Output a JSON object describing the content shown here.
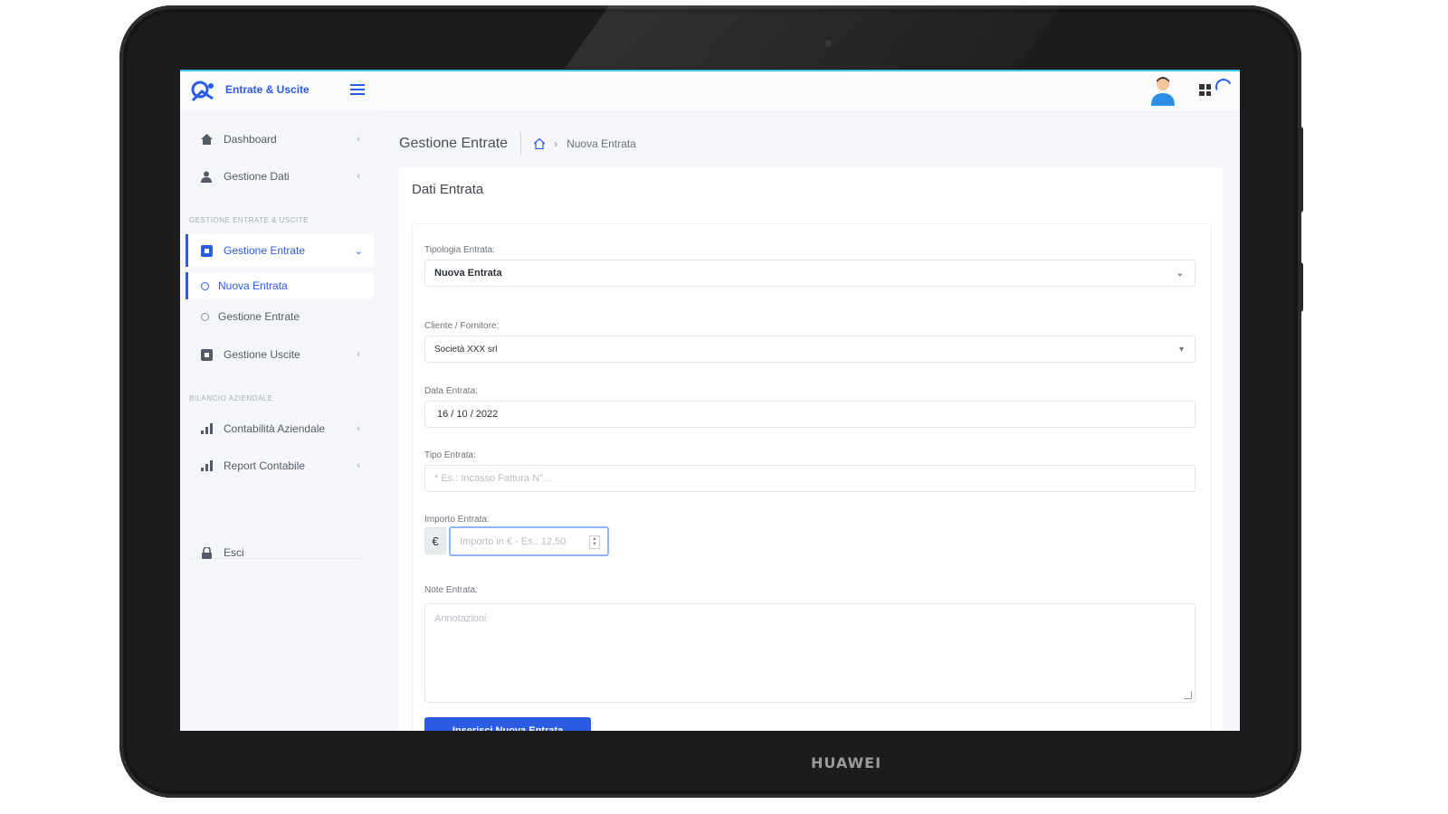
{
  "device": {
    "brand": "HUAWEI"
  },
  "app": {
    "title": "Entrate & Uscite"
  },
  "sidebar": {
    "items": [
      {
        "label": "Dashboard",
        "icon": "home-icon"
      },
      {
        "label": "Gestione Dati",
        "icon": "user-icon"
      }
    ],
    "section1": "GESTIONE ENTRATE & USCITE",
    "entrate": {
      "label": "Gestione Entrate",
      "icon": "calendar-icon"
    },
    "subitems": [
      {
        "label": "Nuova Entrata"
      },
      {
        "label": "Gestione Entrate"
      }
    ],
    "uscite": {
      "label": "Gestione Uscite",
      "icon": "calendar-icon"
    },
    "section2": "BILANCIO AZIENDALE",
    "items2": [
      {
        "label": "Contabilità Aziendale",
        "icon": "bar-chart-icon"
      },
      {
        "label": "Report Contabile",
        "icon": "bar-chart-icon"
      }
    ],
    "logout": {
      "label": "Esci",
      "icon": "lock-icon"
    }
  },
  "header": {
    "title": "Gestione Entrate",
    "breadcrumb_current": "Nuova Entrata"
  },
  "form": {
    "card_title": "Dati Entrata",
    "tipologia": {
      "label": "Tipologia Entrata:",
      "value": "Nuova Entrata"
    },
    "cliente": {
      "label": "Cliente / Fornitore:",
      "value": "Società XXX srl"
    },
    "data": {
      "label": "Data Entrata:",
      "value": "16 / 10 / 2022"
    },
    "tipo": {
      "label": "Tipo Entrata:",
      "placeholder": "* Es.: Incasso Fattura N°..."
    },
    "importo": {
      "label": "Importo Entrata:",
      "currency": "€",
      "placeholder": "Importo in € - Es.: 12,50"
    },
    "note": {
      "label": "Note Entrata:",
      "placeholder": "Annotazioni"
    },
    "submit": "Inserisci Nuova Entrata"
  },
  "colors": {
    "accent": "#2b5ce6",
    "topbar_border": "#3ec4e8"
  }
}
